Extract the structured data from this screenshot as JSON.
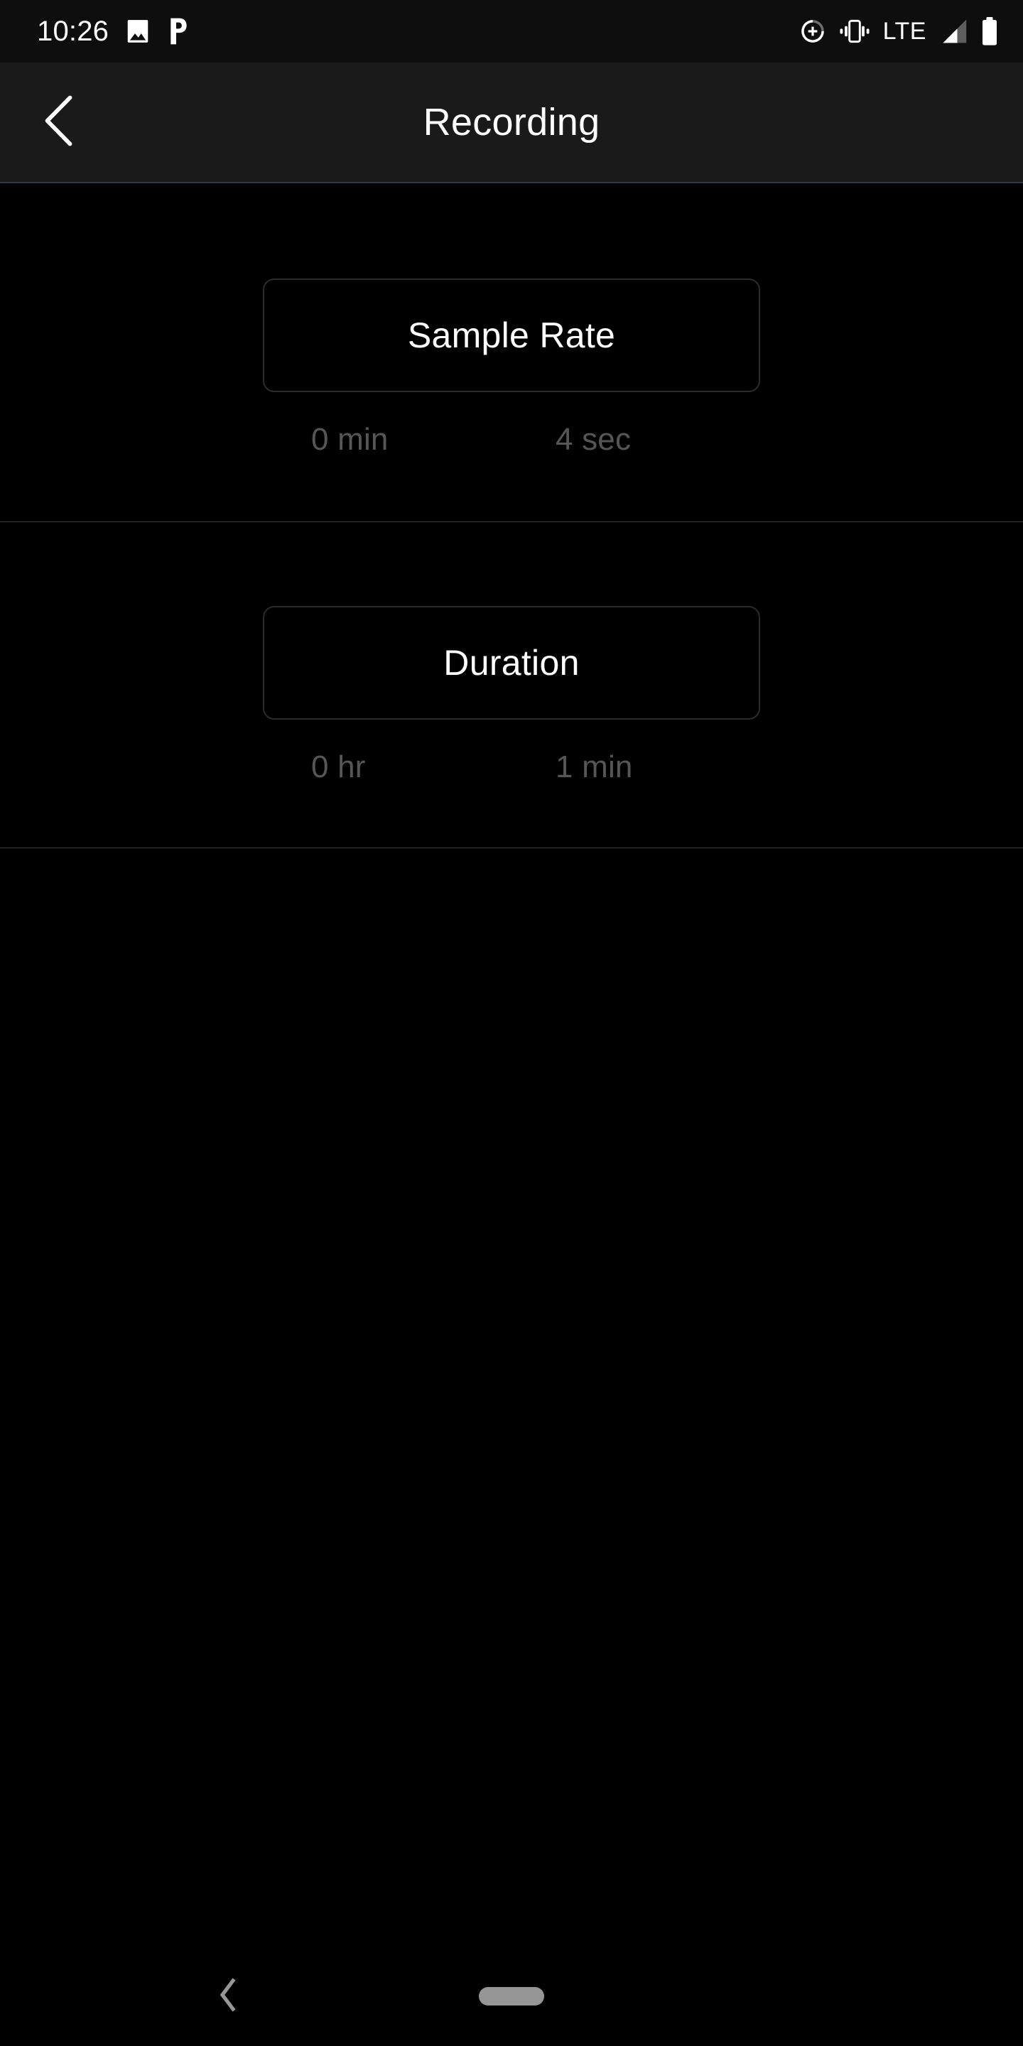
{
  "status_bar": {
    "time": "10:26",
    "network_type": "LTE",
    "left_icons": [
      {
        "name": "photo-icon"
      },
      {
        "name": "pandora-p-icon"
      }
    ],
    "right_icons": [
      {
        "name": "data-saver-add-circle-icon"
      },
      {
        "name": "vibrate-icon"
      },
      {
        "name": "signal-bars-icon"
      },
      {
        "name": "battery-icon"
      }
    ],
    "colors": {
      "background": "#0E0E0E",
      "foreground": "#FFFFFF"
    }
  },
  "app_bar": {
    "title": "Recording",
    "back_icon": "chevron-left-icon",
    "colors": {
      "background": "#1A1A1A",
      "title": "#FFFFFF",
      "underline": "#2C3A44"
    }
  },
  "settings": [
    {
      "id": "sample-rate",
      "button_label": "Sample Rate",
      "values": [
        {
          "id": "minutes",
          "text": "0 min"
        },
        {
          "id": "seconds",
          "text": "4 sec"
        }
      ]
    },
    {
      "id": "duration",
      "button_label": "Duration",
      "values": [
        {
          "id": "hours",
          "text": "0 hr"
        },
        {
          "id": "minutes",
          "text": "1 min"
        }
      ]
    }
  ],
  "nav_bar": {
    "back_icon": "chevron-left-icon",
    "home_handle": "home-pill-handle",
    "colors": {
      "foreground": "#969696",
      "background": "#000000"
    }
  },
  "theme": {
    "page_background": "#000000",
    "button_border": "#2B2B2B",
    "divider": "#3A3A3A",
    "value_text": "#565656",
    "primary_text": "#FFFFFF"
  }
}
